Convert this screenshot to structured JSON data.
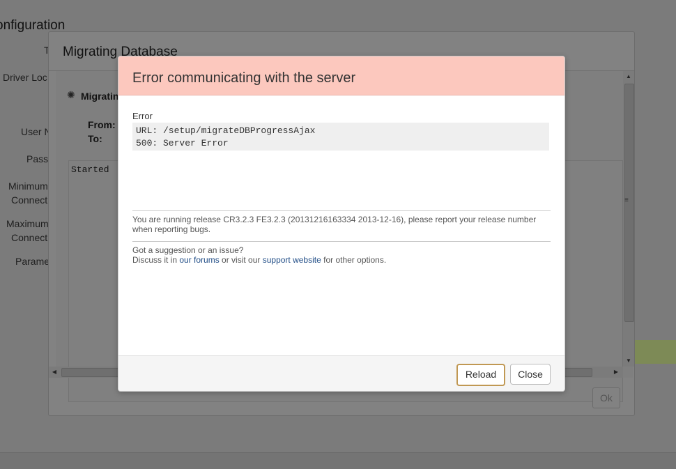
{
  "background": {
    "page_title": "onfiguration",
    "labels": [
      "Driver Loc",
      "User N",
      "Pass",
      "Minimum",
      "Connect",
      "Maximum",
      "Connect",
      "Parame"
    ],
    "row_marker": "T"
  },
  "migrating_dialog": {
    "title": "Migrating Database",
    "status": "Migratin",
    "from_label": "From:",
    "to_label": "To:",
    "log_text": "Started",
    "ok_label": "Ok"
  },
  "error_dialog": {
    "title": "Error communicating with the server",
    "error_label": "Error",
    "url_line": "URL: /setup/migrateDBProgressAjax",
    "status_line": "500: Server Error",
    "release_text": "You are running release CR3.2.3 FE3.2.3 (20131216163334 2013-12-16), please report your release number when reporting bugs.",
    "suggestion": "Got a suggestion or an issue?",
    "discuss_prefix": "Discuss it in ",
    "forums_link": "our forums",
    "discuss_middle": " or visit our ",
    "support_link": "support website",
    "discuss_suffix": " for other options.",
    "reload_label": "Reload",
    "close_label": "Close"
  },
  "colors": {
    "overlay": "#7b7b7b",
    "error_header": "#fcc8be",
    "link": "#1f4c86",
    "reload_border": "#c09853"
  },
  "icons": [
    "spinner-icon",
    "scroll-up-arrow-icon",
    "scroll-down-arrow-icon",
    "scroll-left-arrow-icon",
    "scroll-right-arrow-icon"
  ]
}
